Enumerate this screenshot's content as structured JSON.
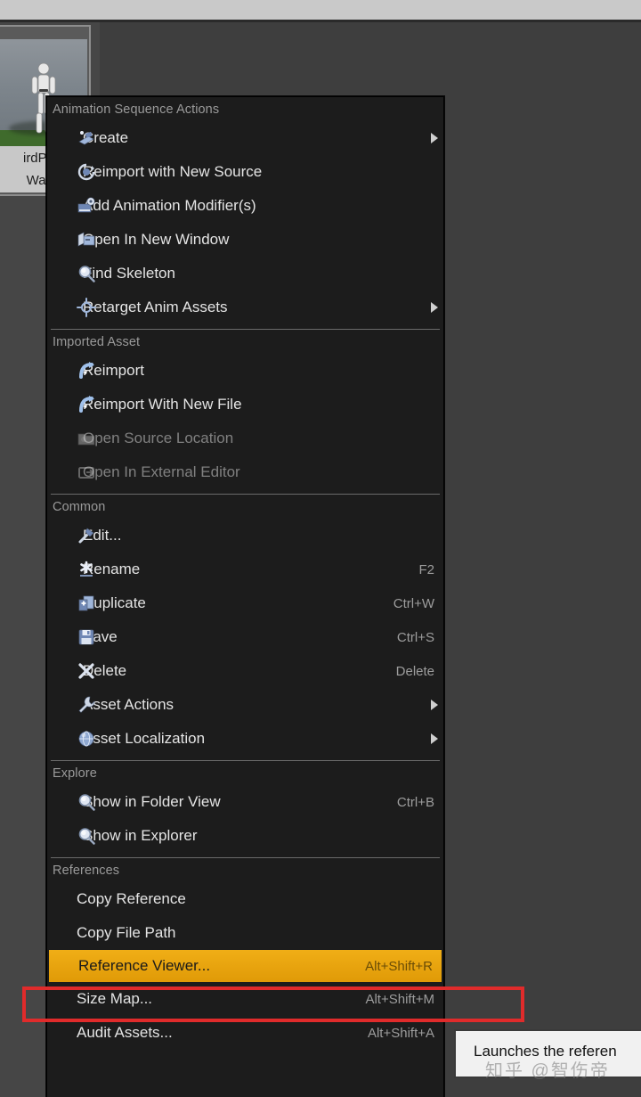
{
  "background": {
    "asset_tile": {
      "label_line1": "irdPer",
      "label_line2": "Walk",
      "thumbnail_icon": "mannequin-character-thumbnail"
    }
  },
  "context_menu": {
    "sections": [
      {
        "title": "Animation Sequence Actions",
        "items": [
          {
            "label": "Create",
            "icon": "create-animation-icon",
            "shortcut": "",
            "submenu": true,
            "disabled": false
          },
          {
            "label": "Reimport with New Source",
            "icon": "reimport-source-icon",
            "shortcut": "",
            "submenu": false,
            "disabled": false
          },
          {
            "label": "Add Animation Modifier(s)",
            "icon": "animation-modifier-icon",
            "shortcut": "",
            "submenu": false,
            "disabled": false
          },
          {
            "label": "Open In New Window",
            "icon": "open-new-window-icon",
            "shortcut": "",
            "submenu": false,
            "disabled": false
          },
          {
            "label": "Find Skeleton",
            "icon": "magnifier-icon",
            "shortcut": "",
            "submenu": false,
            "disabled": false
          },
          {
            "label": "Retarget Anim Assets",
            "icon": "retarget-crosshair-icon",
            "shortcut": "",
            "submenu": true,
            "disabled": false
          }
        ]
      },
      {
        "title": "Imported Asset",
        "items": [
          {
            "label": "Reimport",
            "icon": "reimport-arrow-icon",
            "shortcut": "",
            "submenu": false,
            "disabled": false
          },
          {
            "label": "Reimport With New File",
            "icon": "reimport-arrow-icon",
            "shortcut": "",
            "submenu": false,
            "disabled": false
          },
          {
            "label": "Open Source Location",
            "icon": "open-folder-icon",
            "shortcut": "",
            "submenu": false,
            "disabled": true
          },
          {
            "label": "Open In External Editor",
            "icon": "open-external-editor-icon",
            "shortcut": "",
            "submenu": false,
            "disabled": true
          }
        ]
      },
      {
        "title": "Common",
        "items": [
          {
            "label": "Edit...",
            "icon": "edit-hammer-icon",
            "shortcut": "",
            "submenu": false,
            "disabled": false
          },
          {
            "label": "Rename",
            "icon": "rename-asterisk-icon",
            "shortcut": "F2",
            "submenu": false,
            "disabled": false
          },
          {
            "label": "Duplicate",
            "icon": "duplicate-icon",
            "shortcut": "Ctrl+W",
            "submenu": false,
            "disabled": false
          },
          {
            "label": "Save",
            "icon": "save-floppy-icon",
            "shortcut": "Ctrl+S",
            "submenu": false,
            "disabled": false
          },
          {
            "label": "Delete",
            "icon": "delete-x-icon",
            "shortcut": "Delete",
            "submenu": false,
            "disabled": false
          },
          {
            "label": "Asset Actions",
            "icon": "wrench-icon",
            "shortcut": "",
            "submenu": true,
            "disabled": false
          },
          {
            "label": "Asset Localization",
            "icon": "globe-icon",
            "shortcut": "",
            "submenu": true,
            "disabled": false
          }
        ]
      },
      {
        "title": "Explore",
        "items": [
          {
            "label": "Show in Folder View",
            "icon": "magnifier-icon",
            "shortcut": "Ctrl+B",
            "submenu": false,
            "disabled": false
          },
          {
            "label": "Show in Explorer",
            "icon": "magnifier-icon",
            "shortcut": "",
            "submenu": false,
            "disabled": false
          }
        ]
      },
      {
        "title": "References",
        "items": [
          {
            "label": "Copy Reference",
            "icon": "",
            "shortcut": "",
            "submenu": false,
            "disabled": false
          },
          {
            "label": "Copy File Path",
            "icon": "",
            "shortcut": "",
            "submenu": false,
            "disabled": false
          },
          {
            "label": "Reference Viewer...",
            "icon": "",
            "shortcut": "Alt+Shift+R",
            "submenu": false,
            "disabled": false,
            "highlighted": true
          },
          {
            "label": "Size Map...",
            "icon": "",
            "shortcut": "Alt+Shift+M",
            "submenu": false,
            "disabled": false
          },
          {
            "label": "Audit Assets...",
            "icon": "",
            "shortcut": "Alt+Shift+A",
            "submenu": false,
            "disabled": false
          }
        ]
      }
    ]
  },
  "tooltip": {
    "text": "Launches the referen"
  },
  "watermark": {
    "text": "知乎 @智伤帝"
  },
  "colors": {
    "menu_background": "#1c1c1c",
    "editor_background": "#3e3e3e",
    "highlight": "#e8a317",
    "annotation_red": "#e02b2b",
    "text": "#e4e4e4",
    "disabled_text": "#808080",
    "section_title": "#9a9a9a",
    "shortcut_text": "#9d9d9d"
  }
}
